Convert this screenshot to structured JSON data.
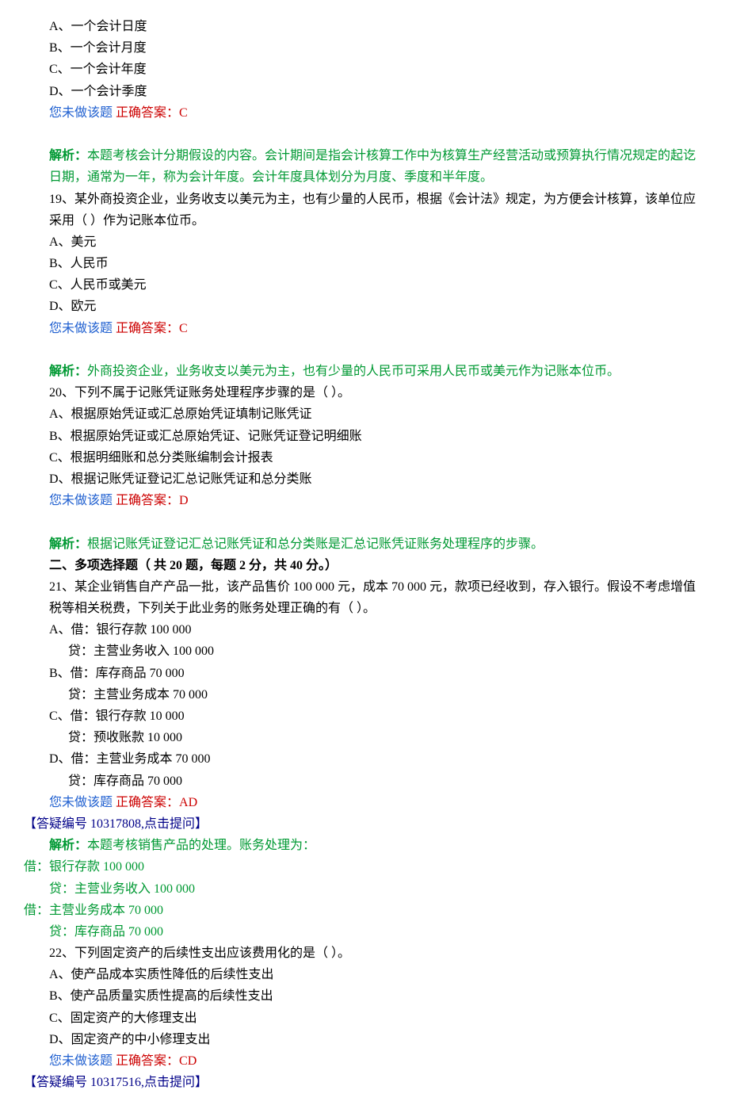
{
  "not_done_label": "您未做该题",
  "correct_label_prefix": "正确答案：",
  "analysis_label": "解析：",
  "q18": {
    "options": {
      "A": "A、一个会计日度",
      "B": "B、一个会计月度",
      "C": "C、一个会计年度",
      "D": "D、一个会计季度"
    },
    "answer": "C",
    "analysis": "本题考核会计分期假设的内容。会计期间是指会计核算工作中为核算生产经营活动或预算执行情况规定的起讫日期，通常为一年，称为会计年度。会计年度具体划分为月度、季度和半年度。"
  },
  "q19": {
    "stem": "19、某外商投资企业，业务收支以美元为主，也有少量的人民币，根据《会计法》规定，为方便会计核算，该单位应采用（ ）作为记账本位币。",
    "options": {
      "A": "A、美元",
      "B": "B、人民币",
      "C": "C、人民币或美元",
      "D": "D、欧元"
    },
    "answer": "C",
    "analysis": "外商投资企业，业务收支以美元为主，也有少量的人民币可采用人民币或美元作为记账本位币。"
  },
  "q20": {
    "stem": "20、下列不属于记账凭证账务处理程序步骤的是（ ）。",
    "options": {
      "A": "A、根据原始凭证或汇总原始凭证填制记账凭证",
      "B": "B、根据原始凭证或汇总原始凭证、记账凭证登记明细账",
      "C": "C、根据明细账和总分类账编制会计报表",
      "D": "D、根据记账凭证登记汇总记账凭证和总分类账"
    },
    "answer": "D",
    "analysis": "根据记账凭证登记汇总记账凭证和总分类账是汇总记账凭证账务处理程序的步骤。"
  },
  "section2_title": "二、多项选择题（ 共 20 题，每题 2 分，共 40 分。）",
  "q21": {
    "stem": "21、某企业销售自产产品一批，该产品售价 100 000 元，成本 70 000 元，款项已经收到，存入银行。假设不考虑增值税等相关税费，下列关于此业务的账务处理正确的有（ ）。",
    "options": {
      "A_line1": "A、借：银行存款 100 000",
      "A_line2": "贷：主营业务收入 100 000",
      "B_line1": "B、借：库存商品 70 000",
      "B_line2": "贷：主营业务成本 70 000",
      "C_line1": "C、借：银行存款 10 000",
      "C_line2": "贷：预收账款 10 000",
      "D_line1": "D、借：主营业务成本 70 000",
      "D_line2": "贷：库存商品 70 000"
    },
    "answer": "AD",
    "qa_link": "【答疑编号 10317808,点击提问】",
    "analysis_intro": "本题考核销售产品的处理。账务处理为：",
    "analysis_lines": {
      "l1": "借：银行存款 100 000",
      "l2": "贷：主营业务收入 100 000",
      "l3": "借：主营业务成本 70 000",
      "l4": "贷：库存商品 70 000"
    }
  },
  "q22": {
    "stem": "22、下列固定资产的后续性支出应该费用化的是（ ）。",
    "options": {
      "A": "A、使产品成本实质性降低的后续性支出",
      "B": "B、使产品质量实质性提高的后续性支出",
      "C": "C、固定资产的大修理支出",
      "D": "D、固定资产的中小修理支出"
    },
    "answer": "CD",
    "qa_link": "【答疑编号 10317516,点击提问】"
  }
}
